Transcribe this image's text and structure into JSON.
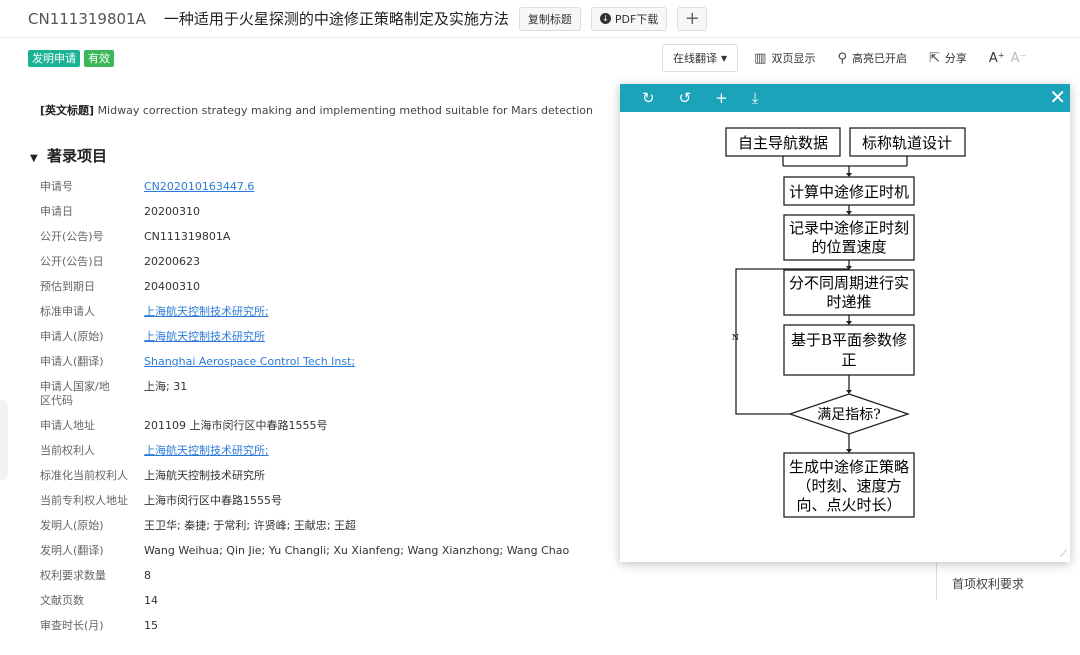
{
  "header": {
    "doc_id": "CN111319801A",
    "title": "一种适用于火星探测的中途修正策略制定及实施方法",
    "copy_title": "复制标题",
    "pdf_download": "PDF下载",
    "add": "+"
  },
  "status_tags": [
    "发明申请",
    "有效"
  ],
  "tools": {
    "translate": "在线翻译",
    "dual_page": "双页显示",
    "highlight": "高亮已开启",
    "share": "分享",
    "font_inc": "A⁺",
    "font_dec": "A⁻"
  },
  "english_title": {
    "label": "[英文标题]",
    "value": "Midway correction strategy making and implementing method suitable for Mars detection"
  },
  "section_title": "著录项目",
  "fields": [
    {
      "k": "申请号",
      "v": "CN202010163447.6",
      "link": true
    },
    {
      "k": "申请日",
      "v": "20200310",
      "link": false
    },
    {
      "k": "公开(公告)号",
      "v": "CN111319801A",
      "link": false
    },
    {
      "k": "公开(公告)日",
      "v": "20200623",
      "link": false
    },
    {
      "k": "预估到期日",
      "v": "20400310",
      "link": false
    },
    {
      "k": "标准申请人",
      "v": "上海航天控制技术研究所;",
      "link": true
    },
    {
      "k": "申请人(原始)",
      "v": "上海航天控制技术研究所",
      "link": true
    },
    {
      "k": "申请人(翻译)",
      "v": "Shanghai Aerospace Control Tech Inst;",
      "link": true
    },
    {
      "k": "申请人国家/地区代码",
      "v": "上海; 31",
      "link": false
    },
    {
      "k": "申请人地址",
      "v": "201109 上海市闵行区中春路1555号",
      "link": false
    },
    {
      "k": "当前权利人",
      "v": "上海航天控制技术研究所;",
      "link": true
    },
    {
      "k": "标准化当前权利人",
      "v": "上海航天控制技术研究所",
      "link": false
    },
    {
      "k": "当前专利权人地址",
      "v": "上海市闵行区中春路1555号",
      "link": false
    },
    {
      "k": "发明人(原始)",
      "v": "王卫华; 秦捷; 于常利; 许贤峰; 王献忠; 王超",
      "link": false
    },
    {
      "k": "发明人(翻译)",
      "v": "Wang Weihua; Qin Jie; Yu Changli; Xu Xianfeng; Wang Xianzhong; Wang Chao",
      "link": false
    },
    {
      "k": "权利要求数量",
      "v": "8",
      "link": false
    },
    {
      "k": "文献页数",
      "v": "14",
      "link": false
    },
    {
      "k": "审查时长(月)",
      "v": "15",
      "link": false
    }
  ],
  "right_nav": {
    "first_claim": "首项权利要求"
  },
  "flowchart": {
    "box_nav": "自主导航数据",
    "box_orbit": "标称轨道设计",
    "step1": "计算中途修正时机",
    "step2_l1": "记录中途修正时刻",
    "step2_l2": "的位置速度",
    "step3_l1": "分不同周期进行实",
    "step3_l2": "时递推",
    "step4_l1": "基于B平面参数修",
    "step4_l2": "正",
    "decision": "满足指标?",
    "n_label": "N",
    "final_l1": "生成中途修正策略",
    "final_l2": "（时刻、速度方",
    "final_l3": "向、点火时长）"
  }
}
